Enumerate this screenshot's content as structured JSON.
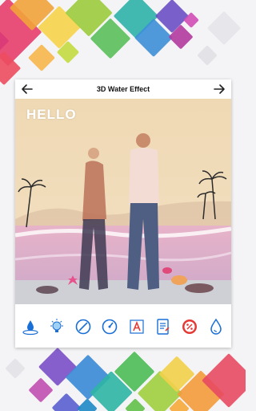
{
  "header": {
    "title": "3D Water Effect"
  },
  "canvas": {
    "overlay_text": "HELLO"
  },
  "toolbar": {
    "tools": [
      {
        "icon": "water-drop-ripple-icon"
      },
      {
        "icon": "light-bulb-icon"
      },
      {
        "icon": "eraser-slash-icon"
      },
      {
        "icon": "opacity-dial-icon"
      },
      {
        "icon": "text-frame-icon"
      },
      {
        "icon": "document-edit-icon"
      },
      {
        "icon": "percent-badge-icon"
      },
      {
        "icon": "water-drop-icon"
      }
    ]
  },
  "colors": {
    "accent": "#1a6fd6",
    "tool_red": "#e53935"
  }
}
